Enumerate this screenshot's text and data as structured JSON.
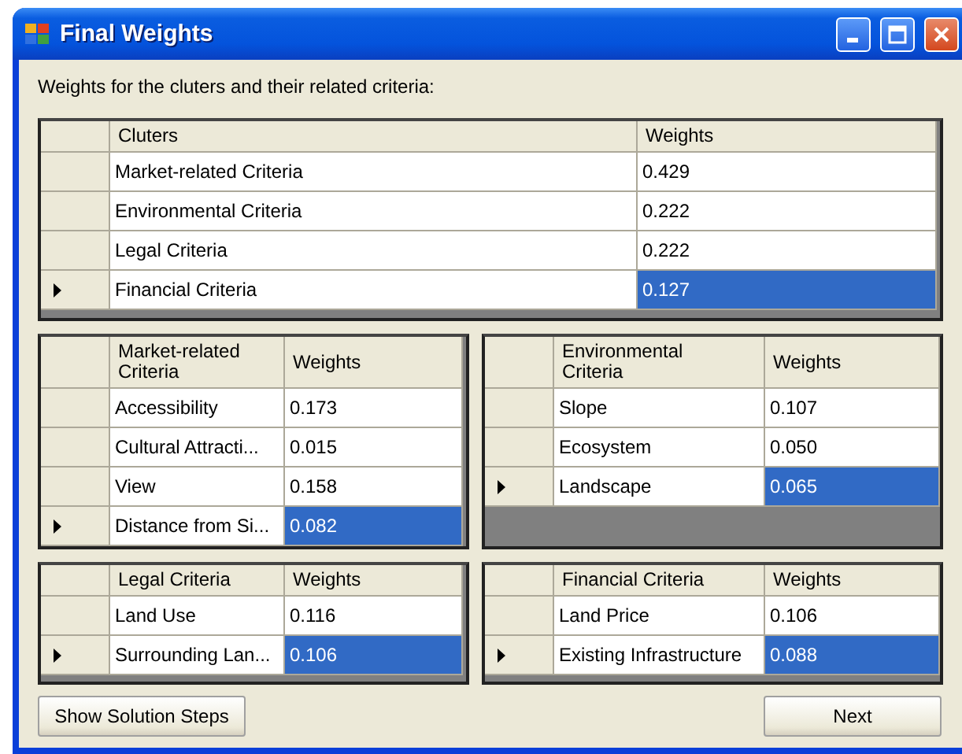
{
  "window": {
    "title": "Final Weights"
  },
  "intro": "Weights for the cluters and their related criteria:",
  "grids": [
    {
      "columns": [
        "Cluters",
        "Weights"
      ],
      "rows": [
        {
          "name": "Market-related Criteria",
          "weight": "0.429",
          "selected": false
        },
        {
          "name": "Environmental Criteria",
          "weight": "0.222",
          "selected": false
        },
        {
          "name": "Legal Criteria",
          "weight": "0.222",
          "selected": false
        },
        {
          "name": "Financial Criteria",
          "weight": "0.127",
          "selected": true
        }
      ]
    },
    {
      "columns": [
        "Market-related Criteria",
        "Weights"
      ],
      "rows": [
        {
          "name": "Accessibility",
          "weight": "0.173",
          "selected": false
        },
        {
          "name": "Cultural Attracti...",
          "weight": "0.015",
          "selected": false
        },
        {
          "name": "View",
          "weight": "0.158",
          "selected": false
        },
        {
          "name": "Distance from Si...",
          "weight": "0.082",
          "selected": true
        }
      ]
    },
    {
      "columns": [
        "Environmental Criteria",
        "Weights"
      ],
      "rows": [
        {
          "name": "Slope",
          "weight": "0.107",
          "selected": false
        },
        {
          "name": "Ecosystem",
          "weight": "0.050",
          "selected": false
        },
        {
          "name": "Landscape",
          "weight": "0.065",
          "selected": true
        }
      ]
    },
    {
      "columns": [
        "Legal Criteria",
        "Weights"
      ],
      "rows": [
        {
          "name": "Land Use",
          "weight": "0.116",
          "selected": false
        },
        {
          "name": "Surrounding Lan...",
          "weight": "0.106",
          "selected": true
        }
      ]
    },
    {
      "columns": [
        "Financial Criteria",
        "Weights"
      ],
      "rows": [
        {
          "name": "Land Price",
          "weight": "0.106",
          "selected": false
        },
        {
          "name": "Existing Infrastructure",
          "weight": "0.088",
          "selected": true
        }
      ]
    }
  ],
  "buttons": [
    "Show Solution Steps",
    "Next"
  ]
}
